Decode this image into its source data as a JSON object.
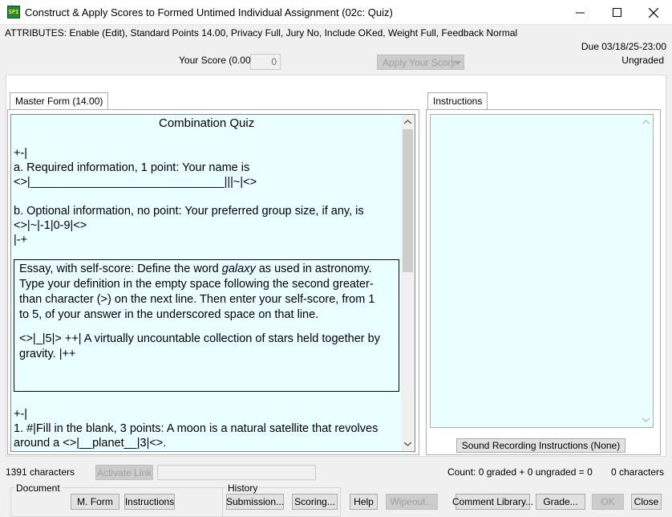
{
  "window": {
    "title": "Construct & Apply Scores to Formed Untimed Individual Assignment (02c: Quiz)",
    "app_icon_text": "SPI"
  },
  "attributes_line": "ATTRIBUTES: Enable (Edit), Standard Points 14.00, Privacy Full, Jury No, Include OKed, Weight Full, Feedback Normal",
  "due": "Due 03/18/25-23:00",
  "grade_status": "Ungraded",
  "score": {
    "label": "Your Score (0.00)",
    "value": "0",
    "apply_button": "Apply Your Score"
  },
  "tabs": {
    "master_form": "Master Form (14.00)",
    "instructions": "Instructions"
  },
  "quiz": {
    "title": "Combination Quiz",
    "line1": "+-|",
    "item_a": "a. Required information, 1 point: Your name is",
    "item_a_field": "<>|______________________________|||~|<>",
    "item_b": "b. Optional information, no point: Your preferred group size, if any, is",
    "item_b_field": "<>|~|-1|0-9|<>",
    "line_end": "|-+",
    "essay_prefix": "Essay, with self-score: Define the word ",
    "essay_word": "galaxy",
    "essay_rest_1": " as used in astronomy.",
    "essay_line2": "Type your definition in the empty space following the second greater-",
    "essay_line3": "than character (>) on the next line. Then enter your self-score, from 1",
    "essay_line4": "to 5, of your answer in the underscored space on that line.",
    "essay_answer_1": "<>|_|5|> ++| A virtually uncountable collection of stars held together by",
    "essay_answer_2": "gravity. |++",
    "line3": "+-|",
    "item_1": "1. #|Fill in the blank, 3 points: A moon is a natural satellite that revolves",
    "item_1_cont": "around a <>|__planet__|3|<>."
  },
  "sound_button": "Sound Recording Instructions (None)",
  "status": {
    "left_chars": "1391 characters",
    "activate_link": "Activate Link",
    "count": "Count: 0 graded + 0 ungraded = 0",
    "right_chars": "0 characters"
  },
  "document_group": {
    "label": "Document",
    "mform": "M. Form",
    "instructions": "Instructions"
  },
  "history_group": {
    "label": "History",
    "submission": "Submission...",
    "scoring": "Scoring..."
  },
  "bottom_buttons": {
    "help": "Help",
    "wipeout": "Wipeout...",
    "comment_library": "Comment Library...",
    "grade": "Grade...",
    "ok": "OK",
    "close": "Close"
  }
}
